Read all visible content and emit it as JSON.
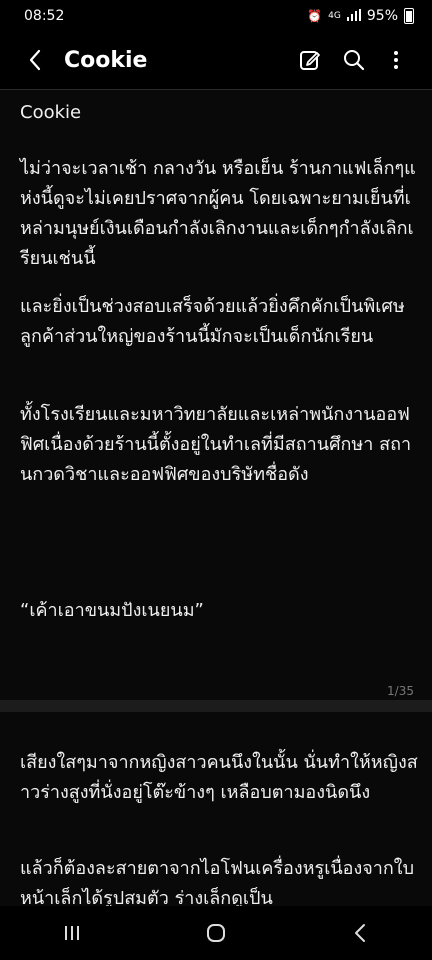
{
  "status": {
    "time": "08:52",
    "network": "4G",
    "battery": "95%"
  },
  "toolbar": {
    "title": "Cookie"
  },
  "document": {
    "title": "Cookie",
    "page1": {
      "p1": "ไม่ว่าจะเวลาเช้า กลางวัน หรือเย็น ร้านกาแฟเล็กๆแห่งนี้ดูจะไม่เคยปราศจากผู้คน โดยเฉพาะยามเย็นที่เหล่ามนุษย์เงินเดือนกำลังเลิกงานและเด็กๆกำลังเลิกเรียนเช่นนี้",
      "p2": "และยิ่งเป็นช่วงสอบเสร็จด้วยแล้วยิ่งคึกคักเป็นพิเศษ ลูกค้าส่วนใหญ่ของร้านนี้มักจะเป็นเด็กนักเรียน",
      "p3": "ทั้งโรงเรียนและมหาวิทยาลัยและเหล่าพนักงานออฟฟิศเนื่องด้วยร้านนี้ตั้งอยู่ในทำเลที่มีสถานศึกษา สถานกวดวิชาและออฟฟิศของบริษัทชื่อดัง",
      "p4": "“เค้าเอาขนมปังเนยนม”",
      "page_number": "1/35"
    },
    "page2": {
      "p1": "เสียงใสๆมาจากหญิงสาวคนนึงในนั้น นั่นทำให้หญิงสาวร่างสูงที่นั่งอยู่โต๊ะข้างๆ เหลือบตามองนิดนึง",
      "p2": "แล้วก็ต้องละสายตาจากไอโฟนเครื่องหรูเนื่องจากใบหน้าเล็กได้รูปสมตัว ร่างเล็กดูเป็น"
    }
  }
}
